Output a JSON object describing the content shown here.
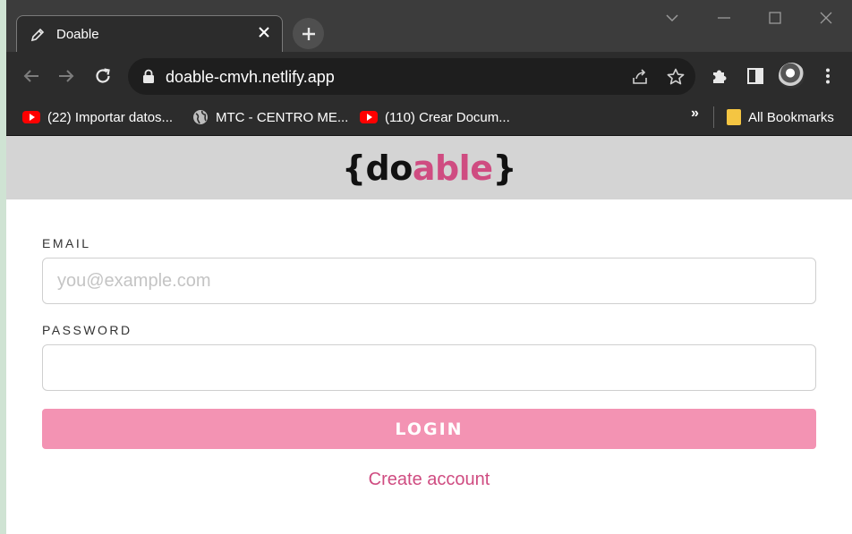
{
  "browser": {
    "tab": {
      "title": "Doable"
    },
    "address": {
      "url": "doable-cmvh.netlify.app"
    },
    "bookmarks": [
      {
        "label": "(22) Importar datos...",
        "icon": "youtube-icon"
      },
      {
        "label": "MTC - CENTRO ME...",
        "icon": "globe-icon"
      },
      {
        "label": "(110) Crear Docum...",
        "icon": "youtube-icon"
      }
    ],
    "bookmarks_overflow": "»",
    "all_bookmarks": "All Bookmarks"
  },
  "page": {
    "logo": {
      "open": "{do",
      "accent": "able",
      "close": "}"
    },
    "email": {
      "label": "EMAIL",
      "placeholder": "you@example.com",
      "value": ""
    },
    "password": {
      "label": "PASSWORD",
      "value": ""
    },
    "login_label": "LOGIN",
    "create_account": "Create account"
  },
  "colors": {
    "accent": "#cf4c81",
    "button": "#f393b3",
    "header_bg": "#d4d4d4",
    "chrome_dark": "#2c2c2c"
  }
}
